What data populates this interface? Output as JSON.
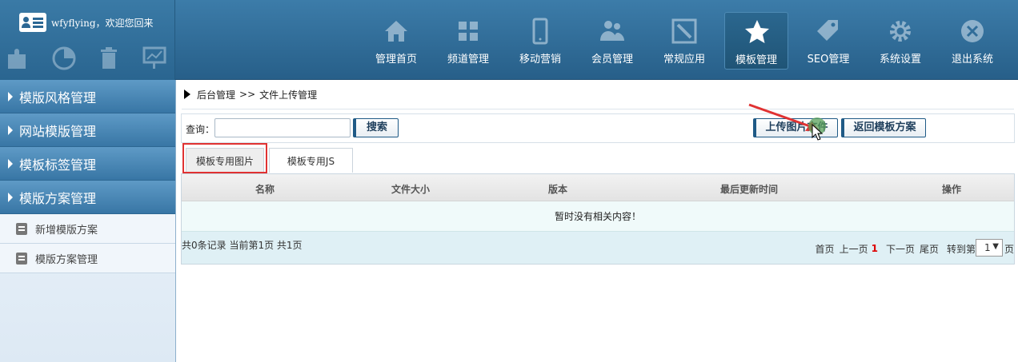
{
  "header": {
    "welcome": "wfyflying，欢迎您回来",
    "quick_icons": [
      "puzzle-icon",
      "pie-chart-icon",
      "trash-icon",
      "presentation-icon"
    ],
    "nav": [
      {
        "label": "管理首页",
        "icon": "home-icon"
      },
      {
        "label": "频道管理",
        "icon": "grid-icon"
      },
      {
        "label": "移动营销",
        "icon": "phone-icon"
      },
      {
        "label": "会员管理",
        "icon": "users-icon"
      },
      {
        "label": "常规应用",
        "icon": "edit-icon"
      },
      {
        "label": "模板管理",
        "icon": "star-icon",
        "active": true
      },
      {
        "label": "SEO管理",
        "icon": "tag-icon"
      },
      {
        "label": "系统设置",
        "icon": "gear-icon"
      },
      {
        "label": "退出系统",
        "icon": "close-icon"
      }
    ]
  },
  "sidebar": {
    "sections": [
      "模版风格管理",
      "网站模版管理",
      "模板标签管理",
      "模版方案管理"
    ],
    "subitems": [
      "新增模版方案",
      "模版方案管理"
    ]
  },
  "breadcrumb": {
    "root": "后台管理",
    "sep": ">>",
    "current": "文件上传管理"
  },
  "toolbar": {
    "query_label": "查询：",
    "query_value": "",
    "search_label": "搜索",
    "upload_label": "上传图片文件",
    "return_label": "返回模板方案"
  },
  "tabs": [
    {
      "label": "模板专用图片",
      "active": true
    },
    {
      "label": "模板专用JS",
      "active": false
    }
  ],
  "table": {
    "columns": [
      "名称",
      "文件大小",
      "版本",
      "最后更新时间",
      "操作"
    ],
    "empty_text": "暂时没有相关内容！"
  },
  "pager": {
    "summary": "共0条记录 当前第1页 共1页",
    "first": "首页",
    "prev": "上一页",
    "current": "1",
    "next": "下一页",
    "last": "尾页",
    "goto_prefix": "转到第",
    "goto_value": "1",
    "goto_suffix": "页"
  },
  "colors": {
    "header": "#2f6c98",
    "accent": "#1f5a86",
    "highlight": "#e03232"
  }
}
